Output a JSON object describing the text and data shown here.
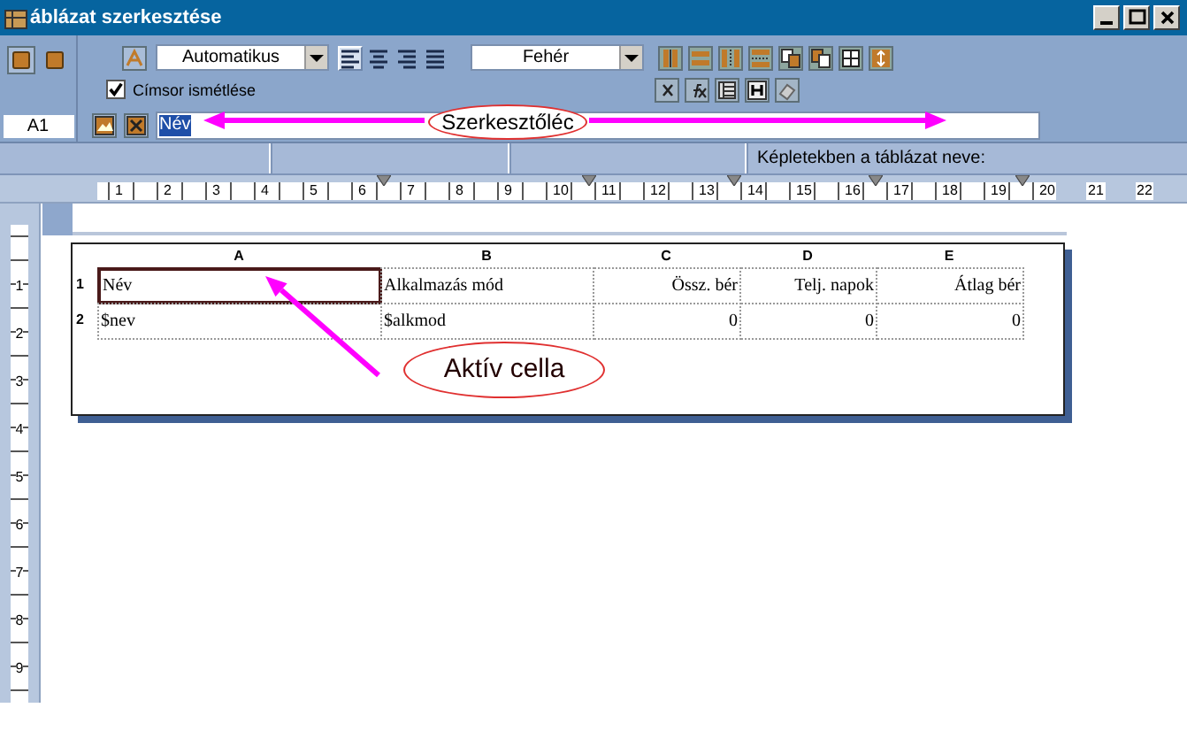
{
  "window": {
    "title": "áblázat szerkesztése"
  },
  "toolbar": {
    "cell_ref": "A1",
    "font_color": "Automatikus",
    "alignment": [
      {
        "selected": true
      },
      {
        "selected": false
      },
      {
        "selected": false
      },
      {
        "selected": false
      }
    ],
    "background": "Fehér",
    "repeat_header": {
      "label": "Címsor ismétlése",
      "checked": true
    },
    "formula": {
      "value": "Név"
    }
  },
  "info_bar": {
    "label": "Képletekben a táblázat neve:"
  },
  "ruler": {
    "numbers": [
      "1",
      "2",
      "3",
      "4",
      "5",
      "6",
      "7",
      "8",
      "9",
      "10",
      "11",
      "12",
      "13",
      "14",
      "15",
      "16",
      "17",
      "18",
      "19",
      "20",
      "21",
      "22"
    ]
  },
  "vertical_ruler": {
    "numbers": [
      "1",
      "2",
      "3",
      "4",
      "5",
      "6",
      "7",
      "8",
      "9"
    ]
  },
  "table": {
    "columns": [
      {
        "label": "A",
        "kind": "text"
      },
      {
        "label": "B",
        "kind": "text"
      },
      {
        "label": "C",
        "kind": "numeric"
      },
      {
        "label": "D",
        "kind": "numeric"
      },
      {
        "label": "E",
        "kind": "numeric"
      }
    ],
    "rows": [
      {
        "number": "1",
        "cells": [
          {
            "text": "Név",
            "selected": true
          },
          {
            "text": "Alkalmazás mód",
            "selected": false
          },
          {
            "text": "Össz. bér",
            "selected": false
          },
          {
            "text": "Telj. napok",
            "selected": false
          },
          {
            "text": "Átlag bér",
            "selected": false
          }
        ]
      },
      {
        "number": "2",
        "cells": [
          {
            "text": "$nev",
            "selected": false
          },
          {
            "text": "$alkmod",
            "selected": false
          },
          {
            "text": "0",
            "selected": false
          },
          {
            "text": "0",
            "selected": false
          },
          {
            "text": "0",
            "selected": false
          }
        ]
      }
    ]
  },
  "annotations": [
    {
      "kind": "formula-bar",
      "label": "Szerkesztőléc"
    },
    {
      "kind": "active-cell",
      "label": "Aktív cella"
    }
  ]
}
